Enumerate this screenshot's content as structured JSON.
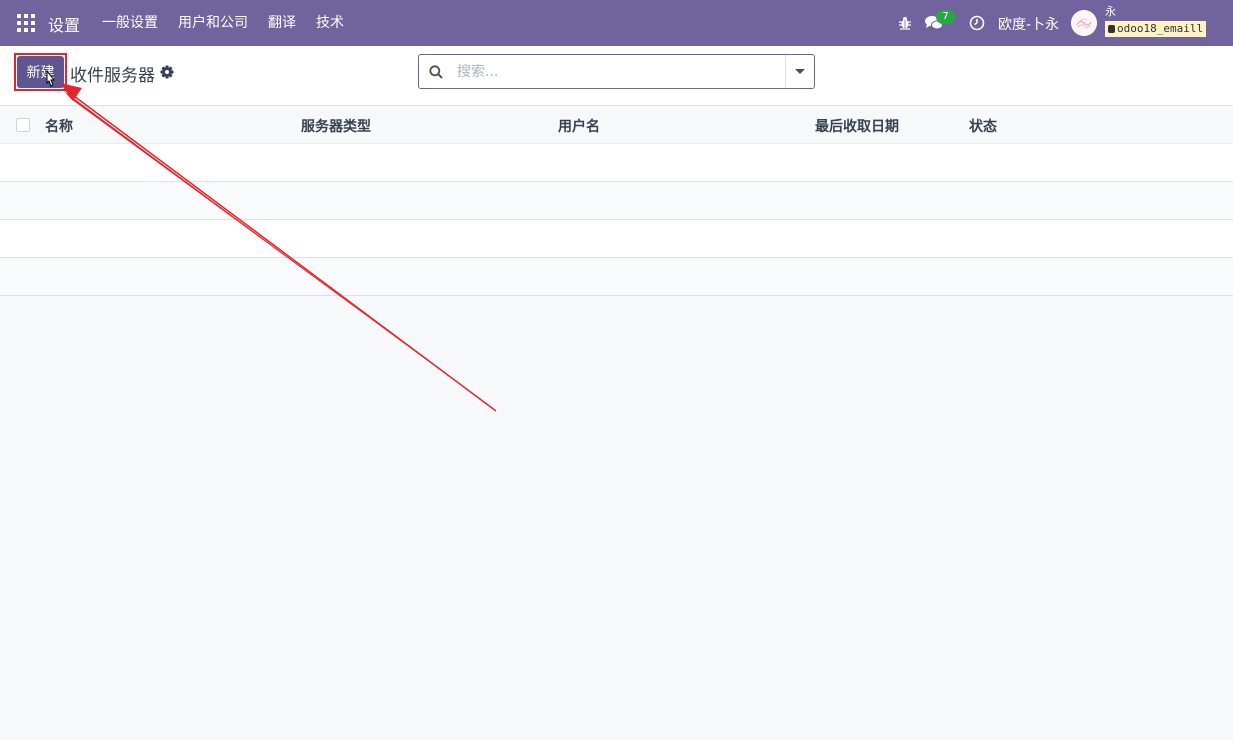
{
  "navbar": {
    "brand": "设置",
    "menu": [
      {
        "label": "一般设置"
      },
      {
        "label": "用户和公司"
      },
      {
        "label": "翻译"
      },
      {
        "label": "技术"
      }
    ],
    "chat_count": "7",
    "company": "欧度-卜永",
    "user_name": "永",
    "database": "odoo18_emaill",
    "colors": {
      "bar": "#71639e",
      "badge": "#28a745"
    }
  },
  "control_panel": {
    "new_label": "新建",
    "title": "收件服务器",
    "search_placeholder": "搜索..."
  },
  "list": {
    "columns": [
      "名称",
      "服务器类型",
      "用户名",
      "最后收取日期",
      "状态"
    ],
    "rows": []
  },
  "icons": [
    "apps-icon",
    "bug-icon",
    "chat-icon",
    "clock-icon",
    "gear-icon",
    "search-icon",
    "caret-down-icon",
    "database-icon",
    "cursor-icon"
  ],
  "annotation": {
    "type": "red-arrow",
    "target": "new-button",
    "color": "#e4252b"
  }
}
